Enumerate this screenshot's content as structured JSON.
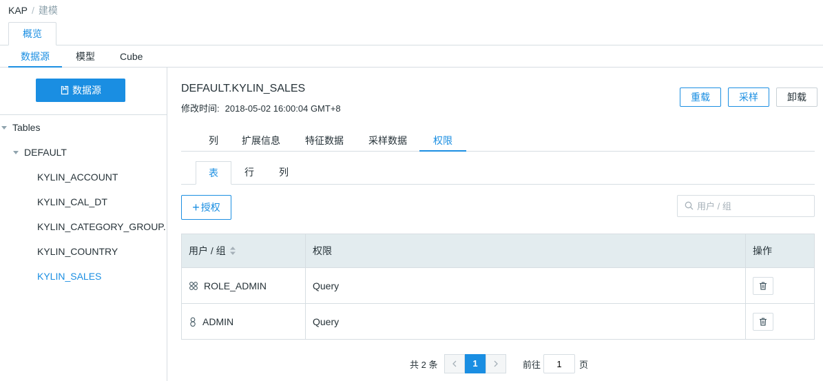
{
  "breadcrumb": {
    "root": "KAP",
    "separator": "/",
    "current": "建模"
  },
  "top_tab": {
    "label": "概览"
  },
  "sub_tabs": [
    {
      "label": "数据源",
      "active": true
    },
    {
      "label": "模型",
      "active": false
    },
    {
      "label": "Cube",
      "active": false
    }
  ],
  "sidebar": {
    "datasource_button": "数据源",
    "tree": {
      "root": "Tables",
      "database": "DEFAULT",
      "tables": [
        "KYLIN_ACCOUNT",
        "KYLIN_CAL_DT",
        "KYLIN_CATEGORY_GROUP...",
        "KYLIN_COUNTRY",
        "KYLIN_SALES"
      ],
      "selected": "KYLIN_SALES"
    }
  },
  "main": {
    "title": "DEFAULT.KYLIN_SALES",
    "modified_label": "修改时间:",
    "modified_value": "2018-05-02 16:00:04 GMT+8",
    "actions": {
      "reload": "重载",
      "sample": "采样",
      "unload": "卸载"
    },
    "detail_tabs": [
      {
        "label": "列",
        "active": false
      },
      {
        "label": "扩展信息",
        "active": false
      },
      {
        "label": "特征数据",
        "active": false
      },
      {
        "label": "采样数据",
        "active": false
      },
      {
        "label": "权限",
        "active": true
      }
    ],
    "perm_tabs": [
      {
        "label": "表",
        "active": true
      },
      {
        "label": "行",
        "active": false
      },
      {
        "label": "列",
        "active": false
      }
    ],
    "grant_button": "授权",
    "search": {
      "placeholder": "用户 / 组",
      "value": ""
    },
    "table": {
      "headers": [
        "用户 / 组",
        "权限",
        "操作"
      ],
      "rows": [
        {
          "user": "ROLE_ADMIN",
          "type_icon": "group-icon",
          "permission": "Query"
        },
        {
          "user": "ADMIN",
          "type_icon": "user-icon",
          "permission": "Query"
        }
      ]
    },
    "pagination": {
      "total": "共 2 条",
      "current_page": "1",
      "goto_label": "前往",
      "goto_value": "1",
      "page_suffix": "页"
    }
  },
  "colors": {
    "accent": "#1a8ee2",
    "header_bg": "#e3ecef",
    "border": "#d6dde2",
    "text": "#263238"
  }
}
